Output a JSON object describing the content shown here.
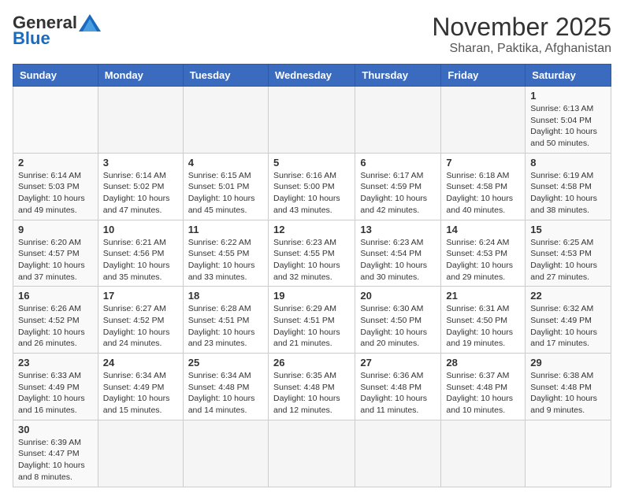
{
  "logo": {
    "general": "General",
    "blue": "Blue"
  },
  "title": "November 2025",
  "subtitle": "Sharan, Paktika, Afghanistan",
  "days_of_week": [
    "Sunday",
    "Monday",
    "Tuesday",
    "Wednesday",
    "Thursday",
    "Friday",
    "Saturday"
  ],
  "weeks": [
    [
      {
        "day": "",
        "info": ""
      },
      {
        "day": "",
        "info": ""
      },
      {
        "day": "",
        "info": ""
      },
      {
        "day": "",
        "info": ""
      },
      {
        "day": "",
        "info": ""
      },
      {
        "day": "",
        "info": ""
      },
      {
        "day": "1",
        "info": "Sunrise: 6:13 AM\nSunset: 5:04 PM\nDaylight: 10 hours\nand 50 minutes."
      }
    ],
    [
      {
        "day": "2",
        "info": "Sunrise: 6:14 AM\nSunset: 5:03 PM\nDaylight: 10 hours\nand 49 minutes."
      },
      {
        "day": "3",
        "info": "Sunrise: 6:14 AM\nSunset: 5:02 PM\nDaylight: 10 hours\nand 47 minutes."
      },
      {
        "day": "4",
        "info": "Sunrise: 6:15 AM\nSunset: 5:01 PM\nDaylight: 10 hours\nand 45 minutes."
      },
      {
        "day": "5",
        "info": "Sunrise: 6:16 AM\nSunset: 5:00 PM\nDaylight: 10 hours\nand 43 minutes."
      },
      {
        "day": "6",
        "info": "Sunrise: 6:17 AM\nSunset: 4:59 PM\nDaylight: 10 hours\nand 42 minutes."
      },
      {
        "day": "7",
        "info": "Sunrise: 6:18 AM\nSunset: 4:58 PM\nDaylight: 10 hours\nand 40 minutes."
      },
      {
        "day": "8",
        "info": "Sunrise: 6:19 AM\nSunset: 4:58 PM\nDaylight: 10 hours\nand 38 minutes."
      }
    ],
    [
      {
        "day": "9",
        "info": "Sunrise: 6:20 AM\nSunset: 4:57 PM\nDaylight: 10 hours\nand 37 minutes."
      },
      {
        "day": "10",
        "info": "Sunrise: 6:21 AM\nSunset: 4:56 PM\nDaylight: 10 hours\nand 35 minutes."
      },
      {
        "day": "11",
        "info": "Sunrise: 6:22 AM\nSunset: 4:55 PM\nDaylight: 10 hours\nand 33 minutes."
      },
      {
        "day": "12",
        "info": "Sunrise: 6:23 AM\nSunset: 4:55 PM\nDaylight: 10 hours\nand 32 minutes."
      },
      {
        "day": "13",
        "info": "Sunrise: 6:23 AM\nSunset: 4:54 PM\nDaylight: 10 hours\nand 30 minutes."
      },
      {
        "day": "14",
        "info": "Sunrise: 6:24 AM\nSunset: 4:53 PM\nDaylight: 10 hours\nand 29 minutes."
      },
      {
        "day": "15",
        "info": "Sunrise: 6:25 AM\nSunset: 4:53 PM\nDaylight: 10 hours\nand 27 minutes."
      }
    ],
    [
      {
        "day": "16",
        "info": "Sunrise: 6:26 AM\nSunset: 4:52 PM\nDaylight: 10 hours\nand 26 minutes."
      },
      {
        "day": "17",
        "info": "Sunrise: 6:27 AM\nSunset: 4:52 PM\nDaylight: 10 hours\nand 24 minutes."
      },
      {
        "day": "18",
        "info": "Sunrise: 6:28 AM\nSunset: 4:51 PM\nDaylight: 10 hours\nand 23 minutes."
      },
      {
        "day": "19",
        "info": "Sunrise: 6:29 AM\nSunset: 4:51 PM\nDaylight: 10 hours\nand 21 minutes."
      },
      {
        "day": "20",
        "info": "Sunrise: 6:30 AM\nSunset: 4:50 PM\nDaylight: 10 hours\nand 20 minutes."
      },
      {
        "day": "21",
        "info": "Sunrise: 6:31 AM\nSunset: 4:50 PM\nDaylight: 10 hours\nand 19 minutes."
      },
      {
        "day": "22",
        "info": "Sunrise: 6:32 AM\nSunset: 4:49 PM\nDaylight: 10 hours\nand 17 minutes."
      }
    ],
    [
      {
        "day": "23",
        "info": "Sunrise: 6:33 AM\nSunset: 4:49 PM\nDaylight: 10 hours\nand 16 minutes."
      },
      {
        "day": "24",
        "info": "Sunrise: 6:34 AM\nSunset: 4:49 PM\nDaylight: 10 hours\nand 15 minutes."
      },
      {
        "day": "25",
        "info": "Sunrise: 6:34 AM\nSunset: 4:48 PM\nDaylight: 10 hours\nand 14 minutes."
      },
      {
        "day": "26",
        "info": "Sunrise: 6:35 AM\nSunset: 4:48 PM\nDaylight: 10 hours\nand 12 minutes."
      },
      {
        "day": "27",
        "info": "Sunrise: 6:36 AM\nSunset: 4:48 PM\nDaylight: 10 hours\nand 11 minutes."
      },
      {
        "day": "28",
        "info": "Sunrise: 6:37 AM\nSunset: 4:48 PM\nDaylight: 10 hours\nand 10 minutes."
      },
      {
        "day": "29",
        "info": "Sunrise: 6:38 AM\nSunset: 4:48 PM\nDaylight: 10 hours\nand 9 minutes."
      }
    ],
    [
      {
        "day": "30",
        "info": "Sunrise: 6:39 AM\nSunset: 4:47 PM\nDaylight: 10 hours\nand 8 minutes."
      },
      {
        "day": "",
        "info": ""
      },
      {
        "day": "",
        "info": ""
      },
      {
        "day": "",
        "info": ""
      },
      {
        "day": "",
        "info": ""
      },
      {
        "day": "",
        "info": ""
      },
      {
        "day": "",
        "info": ""
      }
    ]
  ]
}
